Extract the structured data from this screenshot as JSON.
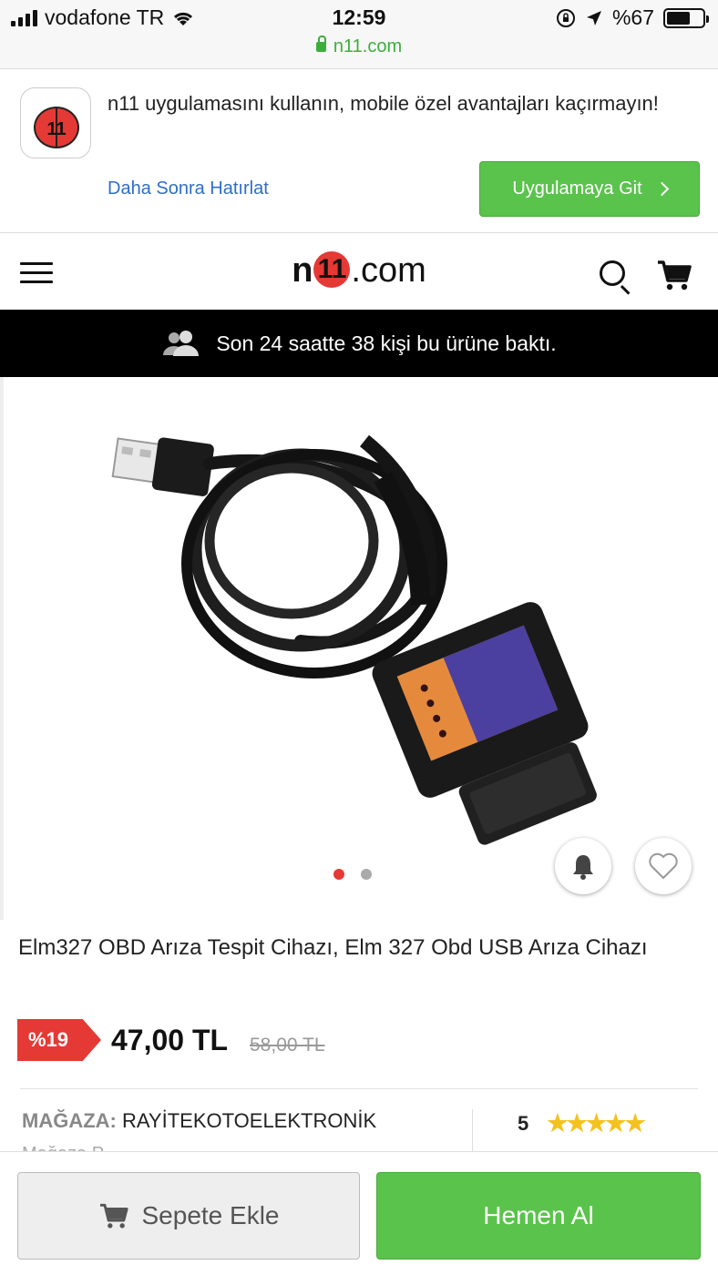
{
  "status_bar": {
    "carrier": "vodafone TR",
    "time": "12:59",
    "battery": "%67",
    "url": "n11.com"
  },
  "app_banner": {
    "message": "n11 uygulamasını kullanın, mobile özel avantajları kaçırmayın!",
    "remind_later": "Daha Sonra Hatırlat",
    "go_to_app": "Uygulamaya Git"
  },
  "header": {
    "logo_prefix": "n",
    "logo_mark": "11",
    "logo_suffix": ".com"
  },
  "viewers_notice": "Son 24 saatte 38 kişi bu ürüne baktı.",
  "gallery": {
    "slide_count": 2,
    "active_slide": 1
  },
  "product": {
    "title": "Elm327 OBD Arıza Tespit Cihazı, Elm 327 Obd USB Arıza Cihazı",
    "discount": "%19",
    "price": "47,00 TL",
    "old_price": "58,00 TL"
  },
  "store": {
    "label": "MAĞAZA:",
    "name": "RAYİTEKOTOELEKTRONİK",
    "rating": "5",
    "stars": "★★★★★",
    "truncated_line": "Mağaza P"
  },
  "actions": {
    "add_to_cart": "Sepete Ekle",
    "buy_now": "Hemen Al"
  },
  "colors": {
    "accent_green": "#5ac34c",
    "brand_red": "#e53935",
    "link_blue": "#2f6dc8"
  },
  "icons": [
    "signal-icon",
    "wifi-icon",
    "lock-icon",
    "location-icon",
    "battery-icon",
    "menu-icon",
    "search-icon",
    "cart-icon",
    "users-icon",
    "bell-icon",
    "heart-icon"
  ]
}
